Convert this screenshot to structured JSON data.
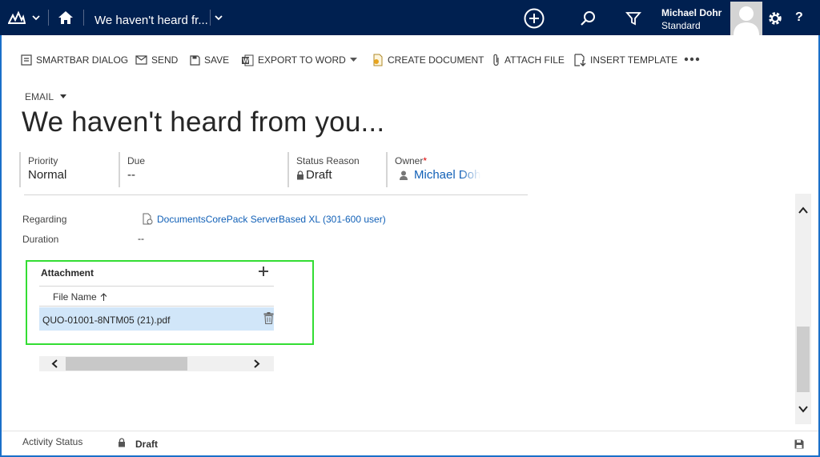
{
  "nav": {
    "title": "We haven't heard fr...",
    "user_name": "Michael Dohr",
    "user_role": "Standard",
    "help_label": "?",
    "brand_color": "#002050"
  },
  "commands": [
    {
      "label": "SMARTBAR DIALOG",
      "icon": "smartbar-icon"
    },
    {
      "label": "SEND",
      "icon": "send-icon"
    },
    {
      "label": "SAVE",
      "icon": "save-icon"
    },
    {
      "label": "EXPORT TO WORD",
      "icon": "word-icon"
    },
    {
      "label": "CREATE DOCUMENT",
      "icon": "create-document-icon"
    },
    {
      "label": "ATTACH FILE",
      "icon": "paperclip-icon"
    },
    {
      "label": "INSERT TEMPLATE",
      "icon": "insert-template-icon"
    }
  ],
  "header": {
    "entity_type": "EMAIL",
    "subject": "We haven't heard from you...",
    "fields": [
      {
        "label": "Priority",
        "value": "Normal"
      },
      {
        "label": "Due",
        "value": "--"
      },
      {
        "label": "Status Reason",
        "value": "Draft"
      },
      {
        "label": "Owner",
        "value": "Michael Doh",
        "required_mark": "*"
      }
    ]
  },
  "form": {
    "regarding_label": "Regarding",
    "regarding_value": "DocumentsCorePack ServerBased XL (301-600 user)",
    "duration_label": "Duration",
    "duration_value": "--"
  },
  "attachments": {
    "title": "Attachment",
    "column_header": "File Name",
    "rows": [
      {
        "file_name": "QUO-01001-8NTM05 (21).pdf"
      }
    ],
    "highlight_color": "#33dd33",
    "selected_row_color": "#d1e6f9"
  },
  "footer": {
    "label": "Activity Status",
    "value": "Draft"
  }
}
